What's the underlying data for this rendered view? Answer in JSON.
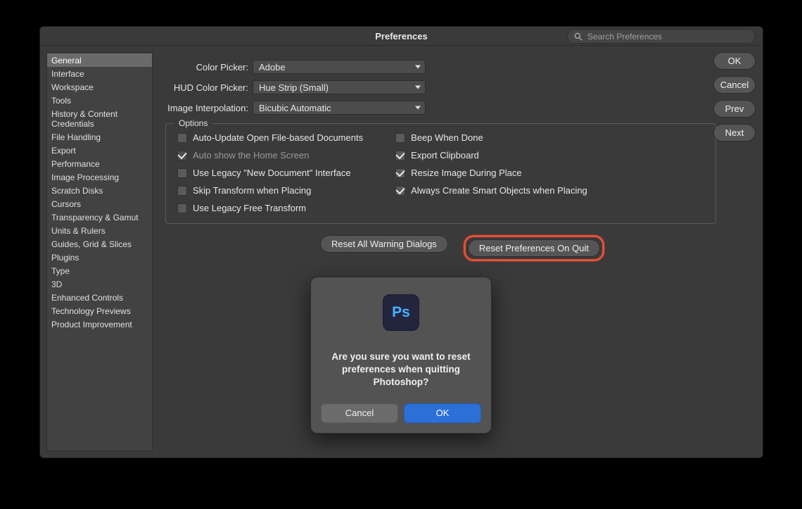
{
  "dialog": {
    "title": "Preferences",
    "search_placeholder": "Search Preferences",
    "buttons": {
      "ok": "OK",
      "cancel": "Cancel",
      "prev": "Prev",
      "next": "Next"
    }
  },
  "sidebar": {
    "items": [
      "General",
      "Interface",
      "Workspace",
      "Tools",
      "History & Content Credentials",
      "File Handling",
      "Export",
      "Performance",
      "Image Processing",
      "Scratch Disks",
      "Cursors",
      "Transparency & Gamut",
      "Units & Rulers",
      "Guides, Grid & Slices",
      "Plugins",
      "Type",
      "3D",
      "Enhanced Controls",
      "Technology Previews",
      "Product Improvement"
    ],
    "selected_index": 0
  },
  "fields": {
    "color_picker": {
      "label": "Color Picker:",
      "value": "Adobe"
    },
    "hud_color_picker": {
      "label": "HUD Color Picker:",
      "value": "Hue Strip (Small)"
    },
    "image_interp": {
      "label": "Image Interpolation:",
      "value": "Bicubic Automatic"
    }
  },
  "options": {
    "legend": "Options",
    "left": [
      {
        "label": "Auto-Update Open File-based Documents",
        "checked": false
      },
      {
        "label": "Auto show the Home Screen",
        "checked": true,
        "disabled": true
      },
      {
        "label": "Use Legacy \"New Document\" Interface",
        "checked": false
      },
      {
        "label": "Skip Transform when Placing",
        "checked": false
      },
      {
        "label": "Use Legacy Free Transform",
        "checked": false
      }
    ],
    "right": [
      {
        "label": "Beep When Done",
        "checked": false
      },
      {
        "label": "Export Clipboard",
        "checked": true
      },
      {
        "label": "Resize Image During Place",
        "checked": true
      },
      {
        "label": "Always Create Smart Objects when Placing",
        "checked": true
      }
    ]
  },
  "bottom": {
    "reset_warnings": "Reset All Warning Dialogs",
    "reset_on_quit": "Reset Preferences On Quit"
  },
  "modal": {
    "app_initials": "Ps",
    "text": "Are you sure you want to reset preferences when quitting Photoshop?",
    "cancel": "Cancel",
    "ok": "OK"
  }
}
